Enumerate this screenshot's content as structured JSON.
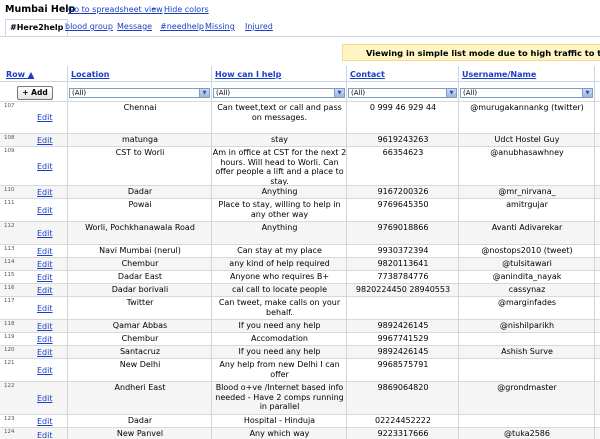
{
  "app": {
    "title": "Mumbai Help",
    "spreadsheet_link": "Go to spreadsheet view",
    "separator": "–",
    "hide_colors": "Hide colors"
  },
  "tabs": [
    "#Here2help",
    "blood group",
    "Message",
    "#needhelp",
    "Missing",
    "Injured"
  ],
  "notice": "Viewing in simple list mode due to high traffic to this document",
  "columns": {
    "row": "Row ▲",
    "location": "Location",
    "how": "How can I help",
    "contact": "Contact",
    "username": "Username/Name"
  },
  "add_button": "+ Add",
  "filter_value": "(All)",
  "edit_label": "Edit",
  "rows": [
    {
      "num": "107",
      "location": "Chennai",
      "how": "Can tweet,text or call and pass on messages.",
      "contact": "0 999 46 929 44",
      "user": "@murugakannankg (twitter)"
    },
    {
      "num": "108",
      "location": "matunga",
      "how": "stay",
      "contact": "9619243263",
      "user": "Udct Hostel Guy"
    },
    {
      "num": "109",
      "location": "CST to Worli",
      "how": "Am in office at CST for the next 2 hours. Will head to Worli. Can offer people a lift and a place to stay.",
      "contact": "66354623",
      "user": "@anubhasawhney"
    },
    {
      "num": "110",
      "location": "Dadar",
      "how": "Anything",
      "contact": "9167200326",
      "user": "@mr_nirvana_"
    },
    {
      "num": "111",
      "location": "Powai",
      "how": "Place to stay, willing to help in any other way",
      "contact": "9769645350",
      "user": "amitrgujar"
    },
    {
      "num": "112",
      "location": "Worli, Pochkhanawala Road",
      "how": "Anything",
      "contact": "9769018866",
      "user": "Avanti Adivarekar"
    },
    {
      "num": "113",
      "location": "Navi Mumbai (nerul)",
      "how": "Can stay at my place",
      "contact": "9930372394",
      "user": "@nostops2010 (tweet)"
    },
    {
      "num": "114",
      "location": "Chembur",
      "how": "any kind of help required",
      "contact": "9820113641",
      "user": "@tulsitawari"
    },
    {
      "num": "115",
      "location": "Dadar East",
      "how": "Anyone who requires B+",
      "contact": "7738784776",
      "user": "@anindita_nayak"
    },
    {
      "num": "116",
      "location": "Dadar borivali",
      "how": "cal call to locate people",
      "contact": "9820224450 28940553",
      "user": "cassynaz"
    },
    {
      "num": "117",
      "location": "Twitter",
      "how": "Can tweet, make calls on your behalf.",
      "contact": "",
      "user": "@marginfades"
    },
    {
      "num": "118",
      "location": "Qamar Abbas",
      "how": "If you need any help",
      "contact": "9892426145",
      "user": "@nishilparikh"
    },
    {
      "num": "119",
      "location": "Chembur",
      "how": "Accomodation",
      "contact": "9967741529",
      "user": ""
    },
    {
      "num": "120",
      "location": "Santacruz",
      "how": "If you need any help",
      "contact": "9892426145",
      "user": "Ashish Surve"
    },
    {
      "num": "121",
      "location": "New Delhi",
      "how": "Any help from new Delhi I can offer",
      "contact": "9968575791",
      "user": ""
    },
    {
      "num": "122",
      "location": "Andheri East",
      "how": "Blood o+ve /Internet based info needed - Have 2 comps running in parallel",
      "contact": "9869064820",
      "user": "@grondmaster"
    },
    {
      "num": "123",
      "location": "Dadar",
      "how": "Hospital - Hinduja",
      "contact": "02224452222",
      "user": ""
    },
    {
      "num": "124",
      "location": "New Panvel",
      "how": "Any which way",
      "contact": "9223317666",
      "user": "@tuka2586"
    }
  ]
}
